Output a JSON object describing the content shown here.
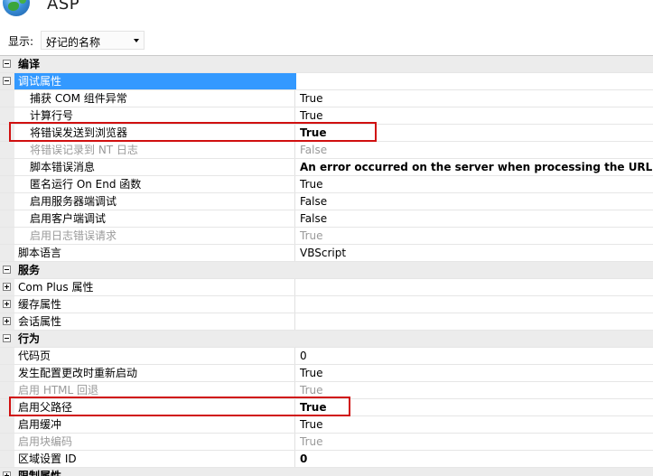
{
  "header": {
    "title": "ASP",
    "icon": "globe-icon"
  },
  "display": {
    "label": "显示:",
    "selected": "好记的名称"
  },
  "sections": [
    {
      "kind": "category",
      "label": "编译",
      "expander": "minus"
    },
    {
      "kind": "subcategory",
      "label": "调试属性",
      "expander": "minus"
    },
    {
      "kind": "prop",
      "indent": true,
      "name": "捕获 COM 组件异常",
      "value": "True"
    },
    {
      "kind": "prop",
      "indent": true,
      "name": "计算行号",
      "value": "True"
    },
    {
      "kind": "prop",
      "indent": true,
      "name": "将错误发送到浏览器",
      "value": "True",
      "bold": true,
      "highlight": true
    },
    {
      "kind": "prop",
      "indent": true,
      "name": "将错误记录到 NT 日志",
      "value": "False",
      "disabled": true
    },
    {
      "kind": "prop",
      "indent": true,
      "name": "脚本错误消息",
      "value": "An error occurred on the server when processing the URL. Pleas",
      "bold": true
    },
    {
      "kind": "prop",
      "indent": true,
      "name": "匿名运行 On End 函数",
      "value": "True"
    },
    {
      "kind": "prop",
      "indent": true,
      "name": "启用服务器端调试",
      "value": "False"
    },
    {
      "kind": "prop",
      "indent": true,
      "name": "启用客户端调试",
      "value": "False"
    },
    {
      "kind": "prop",
      "indent": true,
      "name": "启用日志错误请求",
      "value": "True",
      "disabled": true
    },
    {
      "kind": "prop",
      "indent": false,
      "name": "脚本语言",
      "value": "VBScript"
    },
    {
      "kind": "category",
      "label": "服务",
      "expander": "minus"
    },
    {
      "kind": "group",
      "label": "Com Plus 属性",
      "expander": "plus"
    },
    {
      "kind": "group",
      "label": "缓存属性",
      "expander": "plus"
    },
    {
      "kind": "group",
      "label": "会话属性",
      "expander": "plus"
    },
    {
      "kind": "category",
      "label": "行为",
      "expander": "minus"
    },
    {
      "kind": "prop",
      "indent": false,
      "name": "代码页",
      "value": "0"
    },
    {
      "kind": "prop",
      "indent": false,
      "name": "发生配置更改时重新启动",
      "value": "True"
    },
    {
      "kind": "prop",
      "indent": false,
      "name": "启用 HTML 回退",
      "value": "True",
      "disabled": true
    },
    {
      "kind": "prop",
      "indent": false,
      "name": "启用父路径",
      "value": "True",
      "bold": true,
      "highlight": true
    },
    {
      "kind": "prop",
      "indent": false,
      "name": "启用缓冲",
      "value": "True"
    },
    {
      "kind": "prop",
      "indent": false,
      "name": "启用块编码",
      "value": "True",
      "disabled": true
    },
    {
      "kind": "prop",
      "indent": false,
      "name": "区域设置 ID",
      "value": "0",
      "bold": true
    },
    {
      "kind": "category",
      "label": "限制属性",
      "expander": "plus"
    }
  ],
  "colors": {
    "highlight_box": "#d01010",
    "selection": "#3399ff"
  }
}
